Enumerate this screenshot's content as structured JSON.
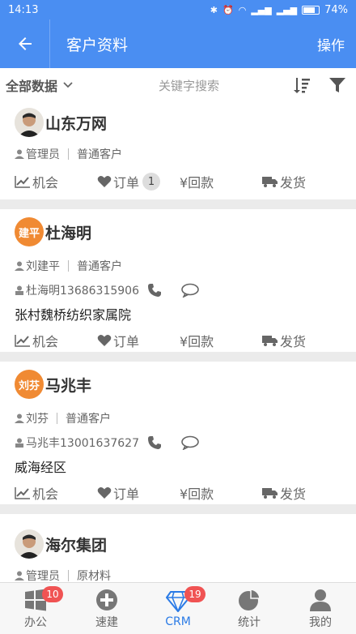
{
  "status": {
    "time": "14:13",
    "battery": "74%"
  },
  "header": {
    "title": "客户资料",
    "action_label": "操作"
  },
  "toolbar": {
    "filter_label": "全部数据",
    "search_placeholder": "关键字搜索"
  },
  "customers": [
    {
      "name": "山东万网",
      "avatar_type": "photo",
      "avatar_text": "",
      "owner": "管理员",
      "type": "普通客户",
      "contact": "",
      "address": "",
      "actions": {
        "opportunity": "机会",
        "order": "订单",
        "order_count": "1",
        "payment": "¥回款",
        "shipment": "发货"
      }
    },
    {
      "name": "杜海明",
      "avatar_type": "text",
      "avatar_text": "建平",
      "owner": "刘建平",
      "type": "普通客户",
      "contact": "杜海明13686315906",
      "address": "张村魏桥纺织家属院",
      "actions": {
        "opportunity": "机会",
        "order": "订单",
        "order_count": "",
        "payment": "¥回款",
        "shipment": "发货"
      }
    },
    {
      "name": "马兆丰",
      "avatar_type": "text",
      "avatar_text": "刘芬",
      "owner": "刘芬",
      "type": "普通客户",
      "contact": "马兆丰13001637627",
      "address": "威海经区",
      "actions": {
        "opportunity": "机会",
        "order": "订单",
        "order_count": "",
        "payment": "¥回款",
        "shipment": "发货"
      }
    },
    {
      "name": "海尔集团",
      "avatar_type": "photo",
      "avatar_text": "",
      "owner": "管理员",
      "type": "原材料",
      "contact": "",
      "address": "",
      "actions": {
        "opportunity": "",
        "order": "",
        "order_count": "",
        "payment": "",
        "shipment": ""
      }
    }
  ],
  "tabs": [
    {
      "label": "办公",
      "badge": "10"
    },
    {
      "label": "速建",
      "badge": ""
    },
    {
      "label": "CRM",
      "badge": "19"
    },
    {
      "label": "统计",
      "badge": ""
    },
    {
      "label": "我的",
      "badge": ""
    }
  ],
  "colors": {
    "primary": "#4a8ef2",
    "active_tab": "#2b7be6",
    "badge_red": "#f05353",
    "avatar_orange": "#f08a33"
  }
}
